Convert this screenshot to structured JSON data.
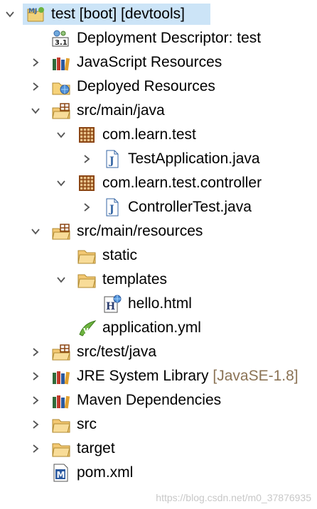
{
  "tree": {
    "rows": [
      {
        "label": "test [boot] [devtools]",
        "decoration": "",
        "icon": "boot-project-icon",
        "level": 0,
        "arrow": "expanded",
        "selected": true
      },
      {
        "label": "Deployment Descriptor: test",
        "decoration": "",
        "icon": "deployment-descriptor-icon",
        "level": 1,
        "arrow": "none"
      },
      {
        "label": "JavaScript Resources",
        "decoration": "",
        "icon": "javascript-resources-icon",
        "level": 1,
        "arrow": "collapsed"
      },
      {
        "label": "Deployed Resources",
        "decoration": "",
        "icon": "deployed-resources-icon",
        "level": 1,
        "arrow": "collapsed"
      },
      {
        "label": "src/main/java",
        "decoration": "",
        "icon": "source-folder-icon",
        "level": 1,
        "arrow": "expanded"
      },
      {
        "label": "com.learn.test",
        "decoration": "",
        "icon": "package-icon",
        "level": 2,
        "arrow": "expanded"
      },
      {
        "label": "TestApplication.java",
        "decoration": "",
        "icon": "java-file-icon",
        "level": 3,
        "arrow": "collapsed"
      },
      {
        "label": "com.learn.test.controller",
        "decoration": "",
        "icon": "package-icon",
        "level": 2,
        "arrow": "expanded"
      },
      {
        "label": "ControllerTest.java",
        "decoration": "",
        "icon": "java-file-icon",
        "level": 3,
        "arrow": "collapsed"
      },
      {
        "label": "src/main/resources",
        "decoration": "",
        "icon": "source-folder-icon",
        "level": 1,
        "arrow": "expanded"
      },
      {
        "label": "static",
        "decoration": "",
        "icon": "folder-icon",
        "level": 2,
        "arrow": "none"
      },
      {
        "label": "templates",
        "decoration": "",
        "icon": "folder-icon",
        "level": 2,
        "arrow": "expanded"
      },
      {
        "label": "hello.html",
        "decoration": "",
        "icon": "html-file-icon",
        "level": 3,
        "arrow": "none"
      },
      {
        "label": "application.yml",
        "decoration": "",
        "icon": "yml-file-icon",
        "level": 2,
        "arrow": "none"
      },
      {
        "label": "src/test/java",
        "decoration": "",
        "icon": "source-folder-icon",
        "level": 1,
        "arrow": "collapsed"
      },
      {
        "label": "JRE System Library",
        "decoration": "[JavaSE-1.8]",
        "icon": "library-icon",
        "level": 1,
        "arrow": "collapsed"
      },
      {
        "label": "Maven Dependencies",
        "decoration": "",
        "icon": "library-icon",
        "level": 1,
        "arrow": "collapsed"
      },
      {
        "label": "src",
        "decoration": "",
        "icon": "folder-icon",
        "level": 1,
        "arrow": "collapsed"
      },
      {
        "label": "target",
        "decoration": "",
        "icon": "folder-icon",
        "level": 1,
        "arrow": "collapsed"
      },
      {
        "label": "pom.xml",
        "decoration": "",
        "icon": "maven-pom-icon",
        "level": 1,
        "arrow": "none"
      }
    ]
  },
  "watermark": "https://blog.csdn.net/m0_37876935",
  "colors": {
    "selection": "#cce4f7",
    "arrow": "#555555",
    "decoration": "#8b7355",
    "folder": "#e8b04a",
    "package": "#a0522d",
    "java_blue": "#3465a4"
  }
}
